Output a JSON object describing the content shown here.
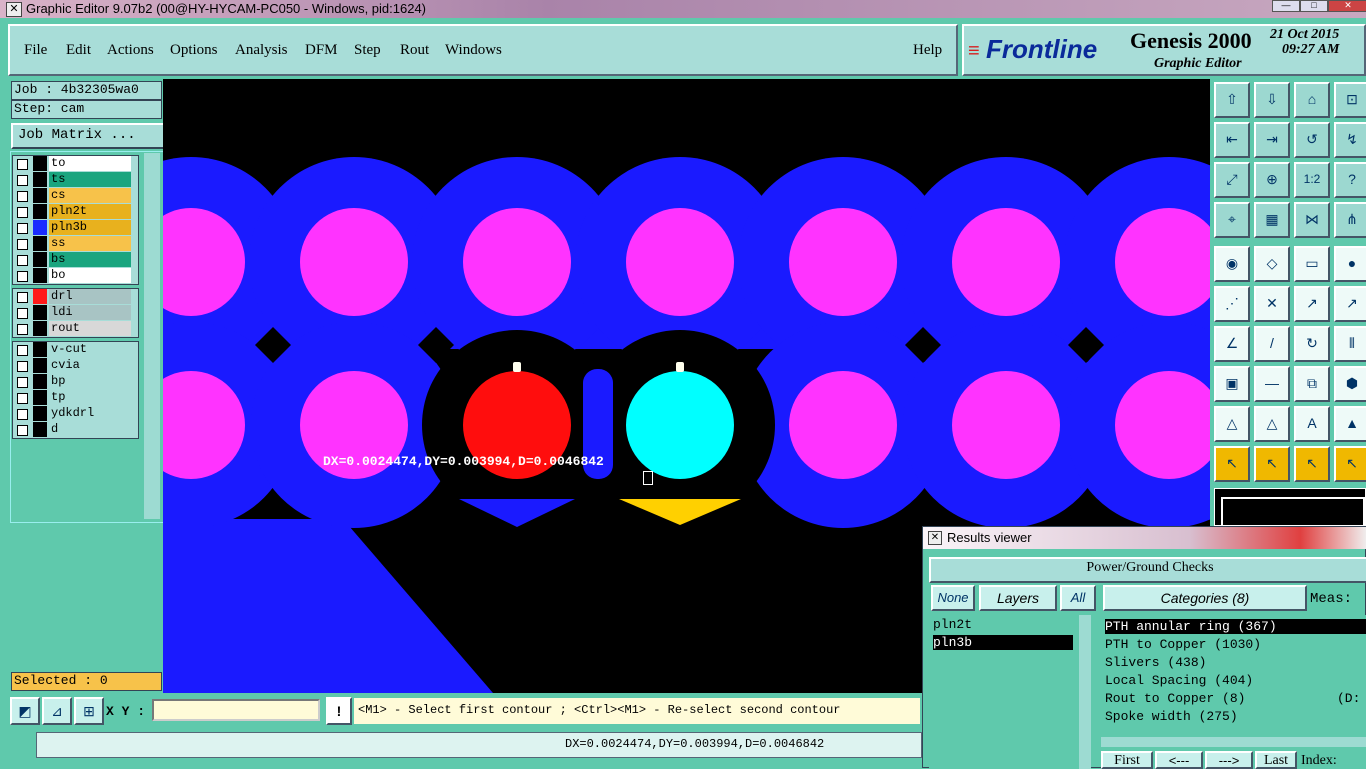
{
  "window": {
    "title": "Graphic Editor 9.07b2 (00@HY-HYCAM-PC050 - Windows, pid:1624)"
  },
  "menu": [
    "File",
    "Edit",
    "Actions",
    "Options",
    "Analysis",
    "DFM",
    "Step",
    "Rout",
    "Windows"
  ],
  "help_label": "Help",
  "logo": {
    "brand": "Frontline",
    "product": "Genesis 2000",
    "subtitle": "Graphic Editor",
    "date": "21 Oct 2015",
    "time": "09:27 AM"
  },
  "job": {
    "job_label": "Job : 4b32305wa0",
    "step_label": "Step: cam",
    "matrix_button": "Job Matrix ..."
  },
  "layers_group1": [
    {
      "name": "to",
      "color": "#ffffff",
      "swatch": "#000000"
    },
    {
      "name": "ts",
      "color": "#1aa57f",
      "swatch": "#000000"
    },
    {
      "name": "cs",
      "color": "#f7c24a",
      "swatch": "#000000"
    },
    {
      "name": "pln2t",
      "color": "#e8b11e",
      "swatch": "#000000"
    },
    {
      "name": "pln3b",
      "color": "#e8b11e",
      "swatch": "#1a2cff"
    },
    {
      "name": "ss",
      "color": "#f7c24a",
      "swatch": "#000000"
    },
    {
      "name": "bs",
      "color": "#1aa57f",
      "swatch": "#000000"
    },
    {
      "name": "bo",
      "color": "#ffffff",
      "swatch": "#000000"
    }
  ],
  "layers_group2": [
    {
      "name": "drl",
      "color": "#a8c4c4",
      "swatch": "#ff1a1a"
    },
    {
      "name": "ldi",
      "color": "#a8c4c4",
      "swatch": "#000000"
    },
    {
      "name": "rout",
      "color": "#d8d8d8",
      "swatch": "#000000"
    }
  ],
  "layers_group3": [
    {
      "name": "v-cut",
      "color": "#a8ddd8",
      "swatch": "#000000"
    },
    {
      "name": "cvia",
      "color": "#a8ddd8",
      "swatch": "#000000"
    },
    {
      "name": "bp",
      "color": "#a8ddd8",
      "swatch": "#000000"
    },
    {
      "name": "tp",
      "color": "#a8ddd8",
      "swatch": "#000000"
    },
    {
      "name": "ydkdrl",
      "color": "#a8ddd8",
      "swatch": "#000000"
    },
    {
      "name": "d",
      "color": "#a8ddd8",
      "swatch": "#000000"
    }
  ],
  "selected": "Selected : 0",
  "canvas": {
    "measure_text": "DX=0.0024474,DY=0.003994,D=0.0046842"
  },
  "cmd": {
    "xy_label": "X Y :",
    "xy_value": "",
    "prompt": "<M1> - Select first contour ; <Ctrl><M1> - Re-select second contour"
  },
  "status": {
    "text": "DX=0.0024474,DY=0.003994,D=0.0046842"
  },
  "results": {
    "title": "Results viewer",
    "header": "Power/Ground Checks",
    "none_label": "None",
    "layers_label": "Layers",
    "all_label": "All",
    "categories_label": "Categories (8)",
    "meas_label": "Meas:",
    "layers": [
      "pln2t",
      "pln3b"
    ],
    "categories": [
      "PTH annular ring (367)",
      "PTH to Copper (1030)",
      "Slivers (438)",
      "Local Spacing (404)",
      "Rout to Copper (8)",
      "Spoke width (275)"
    ],
    "category_extra": "(D:",
    "nav": [
      "First",
      "<---",
      "--->",
      "Last"
    ],
    "index_label": "Index:"
  },
  "colors": {
    "plane": "#1a1aff",
    "pad": "#ff33ff",
    "red": "#ff0d0d",
    "cyan": "#00ffff",
    "yellow": "#ffd000"
  }
}
